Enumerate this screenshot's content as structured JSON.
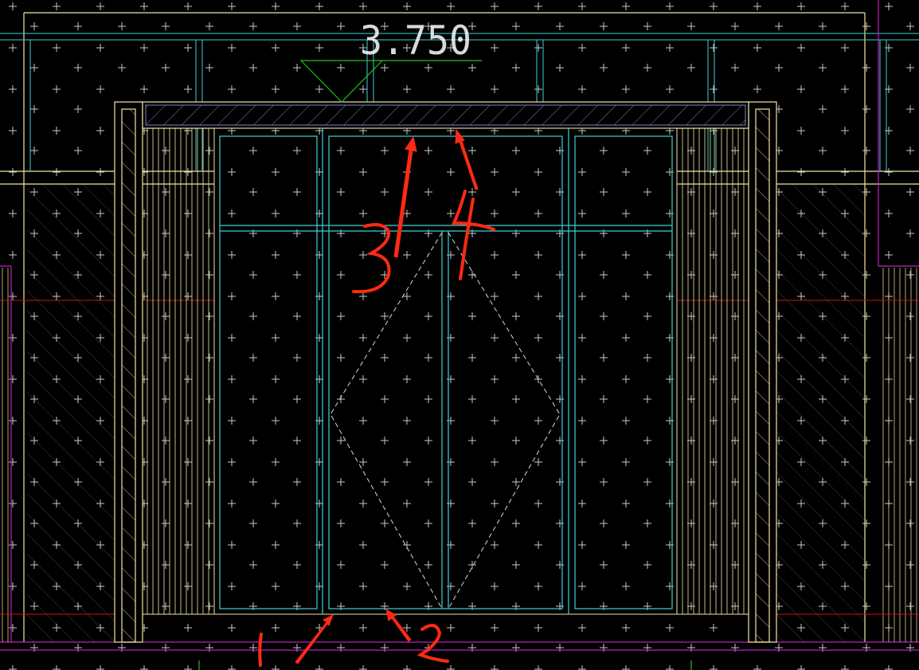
{
  "drawing": {
    "elevation_label": "3.750",
    "annotations": [
      {
        "id": "1",
        "text": "1"
      },
      {
        "id": "2",
        "text": "2"
      },
      {
        "id": "3",
        "text": "3"
      },
      {
        "id": "4",
        "text": "4"
      }
    ],
    "colors": {
      "background": "#000000",
      "frame": "#f2e6a0",
      "glass": "#40d0d8",
      "marker": "#20c020",
      "annotation": "#ff2a14",
      "guide_magenta": "#c020c0",
      "guide_red": "#c01818",
      "hatch_plus": "#c8c8c8"
    }
  }
}
